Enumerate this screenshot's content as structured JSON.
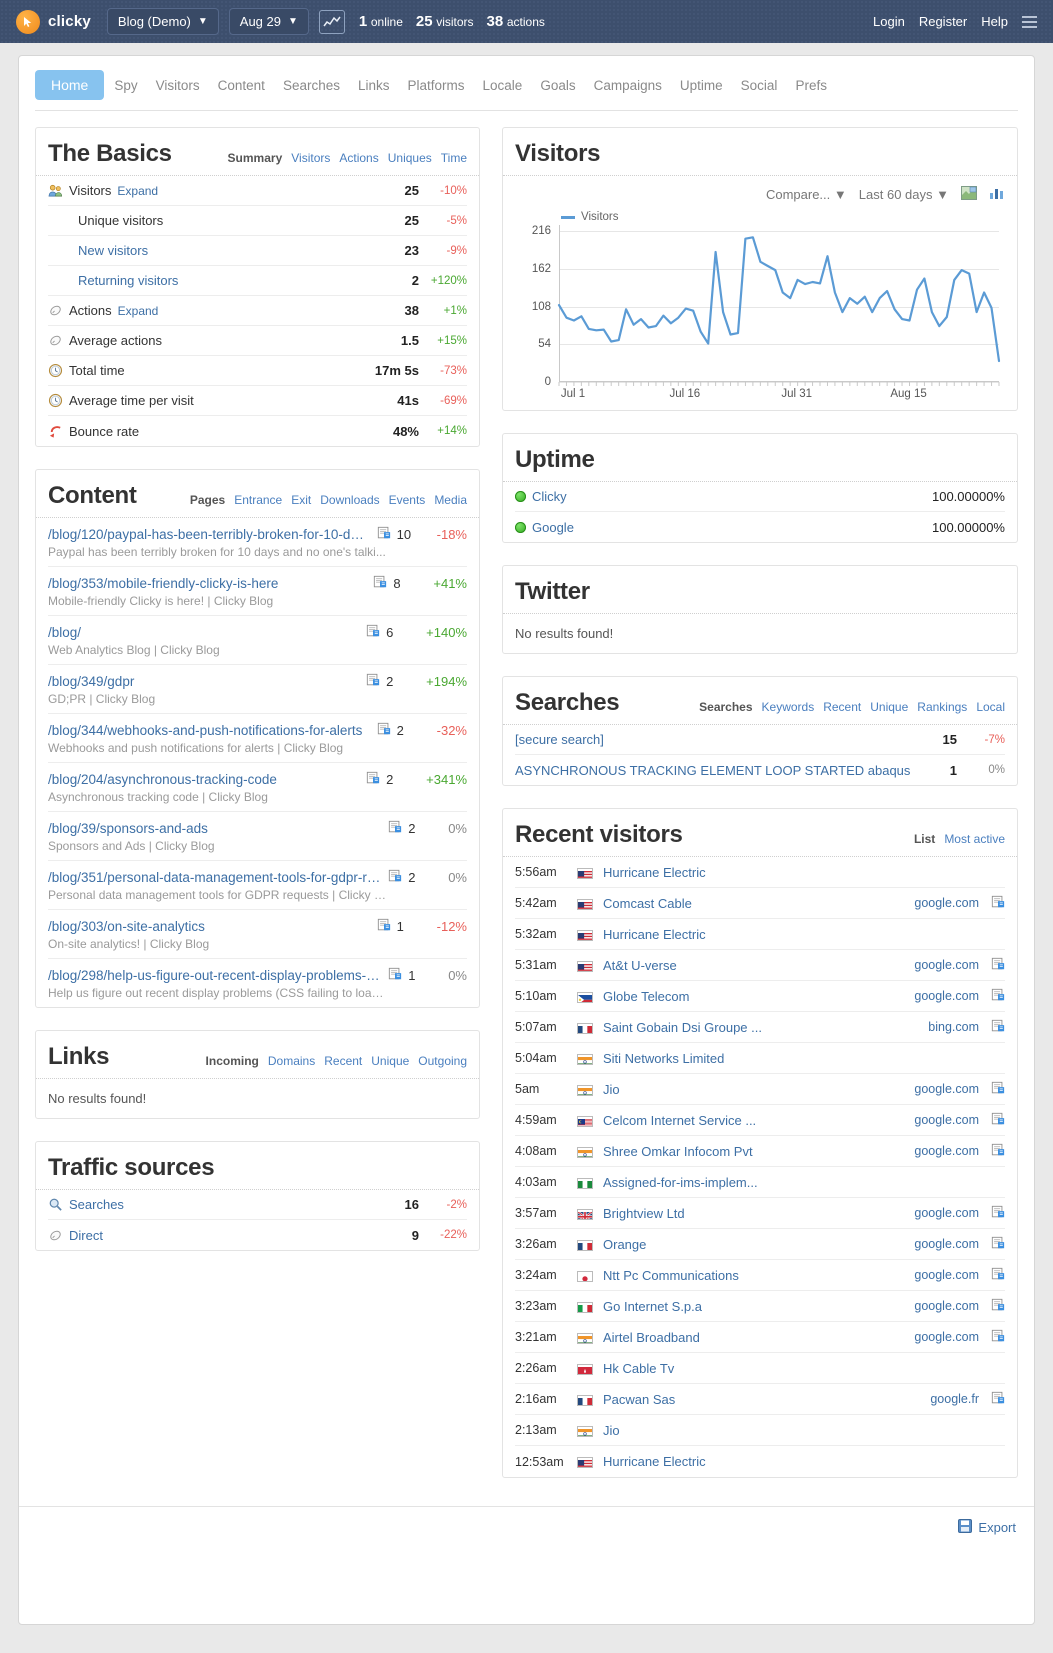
{
  "topbar": {
    "brand": "clicky",
    "site_selector": "Blog (Demo)",
    "date_selector": "Aug 29",
    "caret": "▼",
    "online_count": "1",
    "online_label": "online",
    "visitors_count": "25",
    "visitors_label": "visitors",
    "actions_count": "38",
    "actions_label": "actions",
    "login": "Login",
    "register": "Register",
    "help": "Help"
  },
  "nav": {
    "tabs": [
      {
        "label": "Home",
        "active": true
      },
      {
        "label": "Spy",
        "active": false
      },
      {
        "label": "Visitors",
        "active": false
      },
      {
        "label": "Content",
        "active": false
      },
      {
        "label": "Searches",
        "active": false
      },
      {
        "label": "Links",
        "active": false
      },
      {
        "label": "Platforms",
        "active": false
      },
      {
        "label": "Locale",
        "active": false
      },
      {
        "label": "Goals",
        "active": false
      },
      {
        "label": "Campaigns",
        "active": false
      },
      {
        "label": "Uptime",
        "active": false
      },
      {
        "label": "Social",
        "active": false
      },
      {
        "label": "Prefs",
        "active": false
      }
    ]
  },
  "basics": {
    "title": "The Basics",
    "subnav": [
      "Summary",
      "Visitors",
      "Actions",
      "Uniques",
      "Time"
    ],
    "rows": [
      {
        "icon": "visitors-icon",
        "label": "Visitors",
        "expand": "Expand",
        "value": "25",
        "pct": "-10%",
        "dir": "down",
        "indent": false,
        "link": false
      },
      {
        "icon": "",
        "label": "Unique visitors",
        "expand": "",
        "value": "25",
        "pct": "-5%",
        "dir": "down",
        "indent": true,
        "link": false
      },
      {
        "icon": "",
        "label": "New visitors",
        "expand": "",
        "value": "23",
        "pct": "-9%",
        "dir": "down",
        "indent": true,
        "link": true
      },
      {
        "icon": "",
        "label": "Returning visitors",
        "expand": "",
        "value": "2",
        "pct": "+120%",
        "dir": "up",
        "indent": true,
        "link": true
      },
      {
        "icon": "actions-icon",
        "label": "Actions",
        "expand": "Expand",
        "value": "38",
        "pct": "+1%",
        "dir": "up",
        "indent": false,
        "link": false
      },
      {
        "icon": "actions-icon",
        "label": "Average actions",
        "expand": "",
        "value": "1.5",
        "pct": "+15%",
        "dir": "up",
        "indent": false,
        "link": false
      },
      {
        "icon": "clock-icon",
        "label": "Total time",
        "expand": "",
        "value": "17m 5s",
        "pct": "-73%",
        "dir": "down",
        "indent": false,
        "link": false
      },
      {
        "icon": "clock-icon",
        "label": "Average time per visit",
        "expand": "",
        "value": "41s",
        "pct": "-69%",
        "dir": "down",
        "indent": false,
        "link": false
      },
      {
        "icon": "bounce-icon",
        "label": "Bounce rate",
        "expand": "",
        "value": "48%",
        "pct": "+14%",
        "dir": "up",
        "indent": false,
        "link": false
      }
    ]
  },
  "content": {
    "title": "Content",
    "subnav": [
      "Pages",
      "Entrance",
      "Exit",
      "Downloads",
      "Events",
      "Media"
    ],
    "items": [
      {
        "url": "/blog/120/paypal-has-been-terribly-broken-for-10-days-a...",
        "title": "Paypal has been terribly broken for 10 days and no one's talki...",
        "value": "10",
        "pct": "-18%",
        "dir": "down"
      },
      {
        "url": "/blog/353/mobile-friendly-clicky-is-here",
        "title": "Mobile-friendly Clicky is here! | Clicky Blog",
        "value": "8",
        "pct": "+41%",
        "dir": "up"
      },
      {
        "url": "/blog/",
        "title": "Web Analytics Blog | Clicky Blog",
        "value": "6",
        "pct": "+140%",
        "dir": "up"
      },
      {
        "url": "/blog/349/gdpr",
        "title": "GD;PR | Clicky Blog",
        "value": "2",
        "pct": "+194%",
        "dir": "up"
      },
      {
        "url": "/blog/344/webhooks-and-push-notifications-for-alerts",
        "title": "Webhooks and push notifications for alerts | Clicky Blog",
        "value": "2",
        "pct": "-32%",
        "dir": "down"
      },
      {
        "url": "/blog/204/asynchronous-tracking-code",
        "title": "Asynchronous tracking code | Clicky Blog",
        "value": "2",
        "pct": "+341%",
        "dir": "up"
      },
      {
        "url": "/blog/39/sponsors-and-ads",
        "title": "Sponsors and Ads | Clicky Blog",
        "value": "2",
        "pct": "0%",
        "dir": "flat"
      },
      {
        "url": "/blog/351/personal-data-management-tools-for-gdpr-req...",
        "title": "Personal data management tools for GDPR requests | Clicky Bl...",
        "value": "2",
        "pct": "0%",
        "dir": "flat"
      },
      {
        "url": "/blog/303/on-site-analytics",
        "title": "On-site analytics! | Clicky Blog",
        "value": "1",
        "pct": "-12%",
        "dir": "down"
      },
      {
        "url": "/blog/298/help-us-figure-out-recent-display-problems-cs...",
        "title": "Help us figure out recent display problems (CSS failing to load...",
        "value": "1",
        "pct": "0%",
        "dir": "flat"
      }
    ]
  },
  "links": {
    "title": "Links",
    "subnav": [
      "Incoming",
      "Domains",
      "Recent",
      "Unique",
      "Outgoing"
    ],
    "empty": "No results found!"
  },
  "traffic": {
    "title": "Traffic sources",
    "rows": [
      {
        "icon": "search-icon",
        "label": "Searches",
        "value": "16",
        "pct": "-2%",
        "dir": "down"
      },
      {
        "icon": "direct-icon",
        "label": "Direct",
        "value": "9",
        "pct": "-22%",
        "dir": "down"
      }
    ]
  },
  "visitors_panel": {
    "title": "Visitors",
    "compare_label": "Compare...",
    "range_label": "Last 60 days",
    "caret": "▼"
  },
  "chart_data": {
    "type": "line",
    "title": "Visitors",
    "xlabel": "",
    "ylabel": "",
    "ylim": [
      0,
      216
    ],
    "yticks": [
      0,
      54,
      108,
      162,
      216
    ],
    "grid": true,
    "legend": [
      "Visitors"
    ],
    "legend_position": "top-left",
    "color": "#5b9bd5",
    "xticks": [
      {
        "label": "Jul 1",
        "index": 0
      },
      {
        "label": "Jul 16",
        "index": 15
      },
      {
        "label": "Jul 31",
        "index": 30
      },
      {
        "label": "Aug 15",
        "index": 45
      }
    ],
    "x": [
      "Jul 1",
      "Jul 2",
      "Jul 3",
      "Jul 4",
      "Jul 5",
      "Jul 6",
      "Jul 7",
      "Jul 8",
      "Jul 9",
      "Jul 10",
      "Jul 11",
      "Jul 12",
      "Jul 13",
      "Jul 14",
      "Jul 15",
      "Jul 16",
      "Jul 17",
      "Jul 18",
      "Jul 19",
      "Jul 20",
      "Jul 21",
      "Jul 22",
      "Jul 23",
      "Jul 24",
      "Jul 25",
      "Jul 26",
      "Jul 27",
      "Jul 28",
      "Jul 29",
      "Jul 30",
      "Jul 31",
      "Aug 1",
      "Aug 2",
      "Aug 3",
      "Aug 4",
      "Aug 5",
      "Aug 6",
      "Aug 7",
      "Aug 8",
      "Aug 9",
      "Aug 10",
      "Aug 11",
      "Aug 12",
      "Aug 13",
      "Aug 14",
      "Aug 15",
      "Aug 16",
      "Aug 17",
      "Aug 18",
      "Aug 19",
      "Aug 20",
      "Aug 21",
      "Aug 22",
      "Aug 23",
      "Aug 24",
      "Aug 25",
      "Aug 26",
      "Aug 27",
      "Aug 28",
      "Aug 29"
    ],
    "values": [
      110,
      92,
      88,
      94,
      76,
      74,
      75,
      58,
      60,
      104,
      82,
      90,
      78,
      80,
      95,
      84,
      92,
      105,
      102,
      72,
      55,
      186,
      100,
      68,
      70,
      205,
      207,
      172,
      166,
      160,
      128,
      120,
      146,
      140,
      143,
      141,
      180,
      128,
      100,
      120,
      112,
      122,
      100,
      120,
      130,
      104,
      90,
      88,
      132,
      148,
      100,
      80,
      93,
      146,
      160,
      155,
      100,
      128,
      106,
      30
    ]
  },
  "uptime": {
    "title": "Uptime",
    "rows": [
      {
        "label": "Clicky",
        "value": "100.00000%",
        "status": "up"
      },
      {
        "label": "Google",
        "value": "100.00000%",
        "status": "up"
      }
    ]
  },
  "twitter": {
    "title": "Twitter",
    "empty": "No results found!"
  },
  "searches": {
    "title": "Searches",
    "subnav": [
      "Searches",
      "Keywords",
      "Recent",
      "Unique",
      "Rankings",
      "Local"
    ],
    "rows": [
      {
        "label": "[secure search]",
        "value": "15",
        "pct": "-7%",
        "dir": "down"
      },
      {
        "label": "ASYNCHRONOUS TRACKING ELEMENT LOOP STARTED abaqus",
        "value": "1",
        "pct": "0%",
        "dir": "flat"
      }
    ]
  },
  "recent_visitors": {
    "title": "Recent visitors",
    "subnav": [
      "List",
      "Most active"
    ],
    "rows": [
      {
        "time": "5:56am",
        "country": "us",
        "name": "Hurricane Electric",
        "ref": ""
      },
      {
        "time": "5:42am",
        "country": "us",
        "name": "Comcast Cable",
        "ref": "google.com"
      },
      {
        "time": "5:32am",
        "country": "us",
        "name": "Hurricane Electric",
        "ref": ""
      },
      {
        "time": "5:31am",
        "country": "us",
        "name": "At&t U-verse",
        "ref": "google.com"
      },
      {
        "time": "5:10am",
        "country": "ph",
        "name": "Globe Telecom",
        "ref": "google.com"
      },
      {
        "time": "5:07am",
        "country": "fr",
        "name": "Saint Gobain Dsi Groupe ...",
        "ref": "bing.com"
      },
      {
        "time": "5:04am",
        "country": "in",
        "name": "Siti Networks Limited",
        "ref": ""
      },
      {
        "time": "5am",
        "country": "in",
        "name": "Jio",
        "ref": "google.com"
      },
      {
        "time": "4:59am",
        "country": "my",
        "name": "Celcom Internet Service ...",
        "ref": "google.com"
      },
      {
        "time": "4:08am",
        "country": "in",
        "name": "Shree Omkar Infocom Pvt",
        "ref": "google.com"
      },
      {
        "time": "4:03am",
        "country": "ng",
        "name": "Assigned-for-ims-implem...",
        "ref": ""
      },
      {
        "time": "3:57am",
        "country": "gb",
        "name": "Brightview Ltd",
        "ref": "google.com"
      },
      {
        "time": "3:26am",
        "country": "fr",
        "name": "Orange",
        "ref": "google.com"
      },
      {
        "time": "3:24am",
        "country": "jp",
        "name": "Ntt Pc Communications",
        "ref": "google.com"
      },
      {
        "time": "3:23am",
        "country": "it",
        "name": "Go Internet S.p.a",
        "ref": "google.com"
      },
      {
        "time": "3:21am",
        "country": "in",
        "name": "Airtel Broadband",
        "ref": "google.com"
      },
      {
        "time": "2:26am",
        "country": "hk",
        "name": "Hk Cable Tv",
        "ref": ""
      },
      {
        "time": "2:16am",
        "country": "fr",
        "name": "Pacwan Sas",
        "ref": "google.fr"
      },
      {
        "time": "2:13am",
        "country": "in",
        "name": "Jio",
        "ref": ""
      },
      {
        "time": "12:53am",
        "country": "us",
        "name": "Hurricane Electric",
        "ref": ""
      }
    ]
  },
  "footer": {
    "export_label": "Export"
  },
  "colors": {
    "accent": "#87c3ef",
    "link": "#3d6fa5",
    "up": "#4aa832",
    "down": "#e8605a",
    "topbar": "#3d4f6d"
  }
}
